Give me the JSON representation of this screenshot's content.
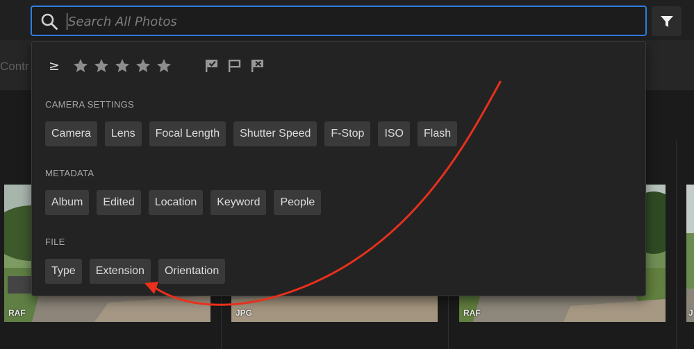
{
  "search": {
    "placeholder": "Search All Photos"
  },
  "background": {
    "subbar_text": "Contr"
  },
  "photos": [
    {
      "tag": "RAF"
    },
    {
      "tag": "JPG"
    },
    {
      "tag": "RAF"
    },
    {
      "tag": "J"
    }
  ],
  "filter_panel": {
    "rating_operator": "≥",
    "stars": 5,
    "flag_icons": [
      "flag-picked-icon",
      "flag-unflagged-icon",
      "flag-rejected-icon"
    ],
    "sections": [
      {
        "title": "CAMERA SETTINGS",
        "chips": [
          "Camera",
          "Lens",
          "Focal Length",
          "Shutter Speed",
          "F-Stop",
          "ISO",
          "Flash"
        ]
      },
      {
        "title": "METADATA",
        "chips": [
          "Album",
          "Edited",
          "Location",
          "Keyword",
          "People"
        ]
      },
      {
        "title": "FILE",
        "chips": [
          "Type",
          "Extension",
          "Orientation"
        ]
      }
    ]
  },
  "colors": {
    "accent": "#2f7de1",
    "annotation_arrow": "#e8301c",
    "chip_bg": "#3a3a3a",
    "panel_bg": "#232323"
  }
}
